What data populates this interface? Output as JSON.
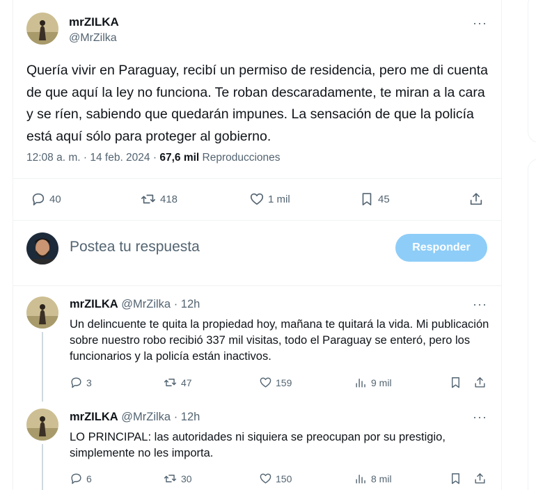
{
  "main_tweet": {
    "author_name": "mrZILKA",
    "author_handle": "@MrZilka",
    "more_label": "···",
    "text": "Quería vivir en Paraguay, recibí un permiso de residencia, pero me di cuenta de que aquí la ley no funciona. Te roban descaradamente, te miran a la cara y se ríen, sabiendo que quedarán impunes. La sensación de que la policía está aquí sólo para proteger al gobierno.",
    "time": "12:08 a. m.",
    "separator": "·",
    "date": "14 feb. 2024",
    "views_count": "67,6 mil",
    "views_label": "Reproducciones",
    "replies": "40",
    "reposts": "418",
    "likes": "1 mil",
    "bookmarks": "45"
  },
  "compose": {
    "placeholder": "Postea tu respuesta",
    "button_label": "Responder"
  },
  "replies": [
    {
      "author_name": "mrZILKA",
      "author_handle": "@MrZilka",
      "age": "· 12h",
      "more_label": "···",
      "text": "Un delincuente te quita la propiedad hoy, mañana te quitará la vida. Mi publicación sobre nuestro robo recibió 337 mil visitas, todo el Paraguay se enteró, pero los funcionarios y la policía están inactivos.",
      "replies": "3",
      "reposts": "47",
      "likes": "159",
      "views": "9 mil"
    },
    {
      "author_name": "mrZILKA",
      "author_handle": "@MrZilka",
      "age": "· 12h",
      "more_label": "···",
      "text": "LO PRINCIPAL: las autoridades ni siquiera se preocupan por su prestigio, simplemente no les importa.",
      "replies": "6",
      "reposts": "30",
      "likes": "150",
      "views": "8 mil"
    }
  ],
  "colors": {
    "text_primary": "#0f1419",
    "text_secondary": "#536471",
    "button_disabled": "#8ecdf8",
    "divider": "#eff3f4"
  }
}
